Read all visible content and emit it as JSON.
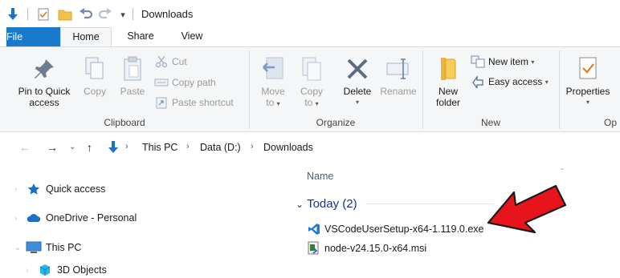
{
  "window": {
    "title": "Downloads"
  },
  "tabs": {
    "file": "File",
    "home": "Home",
    "share": "Share",
    "view": "View"
  },
  "ribbon": {
    "clipboard": {
      "pin_label_1": "Pin to Quick",
      "pin_label_2": "access",
      "copy": "Copy",
      "paste": "Paste",
      "cut": "Cut",
      "copy_path": "Copy path",
      "paste_shortcut": "Paste shortcut",
      "group": "Clipboard"
    },
    "organize": {
      "move_1": "Move",
      "move_2": "to",
      "copy_1": "Copy",
      "copy_2": "to",
      "delete": "Delete",
      "rename": "Rename",
      "group": "Organize"
    },
    "new": {
      "new_folder_1": "New",
      "new_folder_2": "folder",
      "new_item": "New item",
      "easy_access": "Easy access",
      "group": "New"
    },
    "open": {
      "properties": "Properties",
      "group": "Op"
    }
  },
  "address": {
    "crumbs": [
      "This PC",
      "Data (D:)",
      "Downloads"
    ]
  },
  "navpane": {
    "items": [
      "Quick access",
      "OneDrive - Personal",
      "This PC",
      "3D Objects"
    ]
  },
  "content": {
    "column_name": "Name",
    "group_label": "Today (2)",
    "files": [
      "VSCodeUserSetup-x64-1.119.0.exe",
      "node-v24.15.0-x64.msi"
    ]
  },
  "colors": {
    "file_tab": "#1979ca",
    "ribbon_bg": "#f5f6f7",
    "group_header": "#1e3287",
    "arrow": "#e8141c"
  }
}
